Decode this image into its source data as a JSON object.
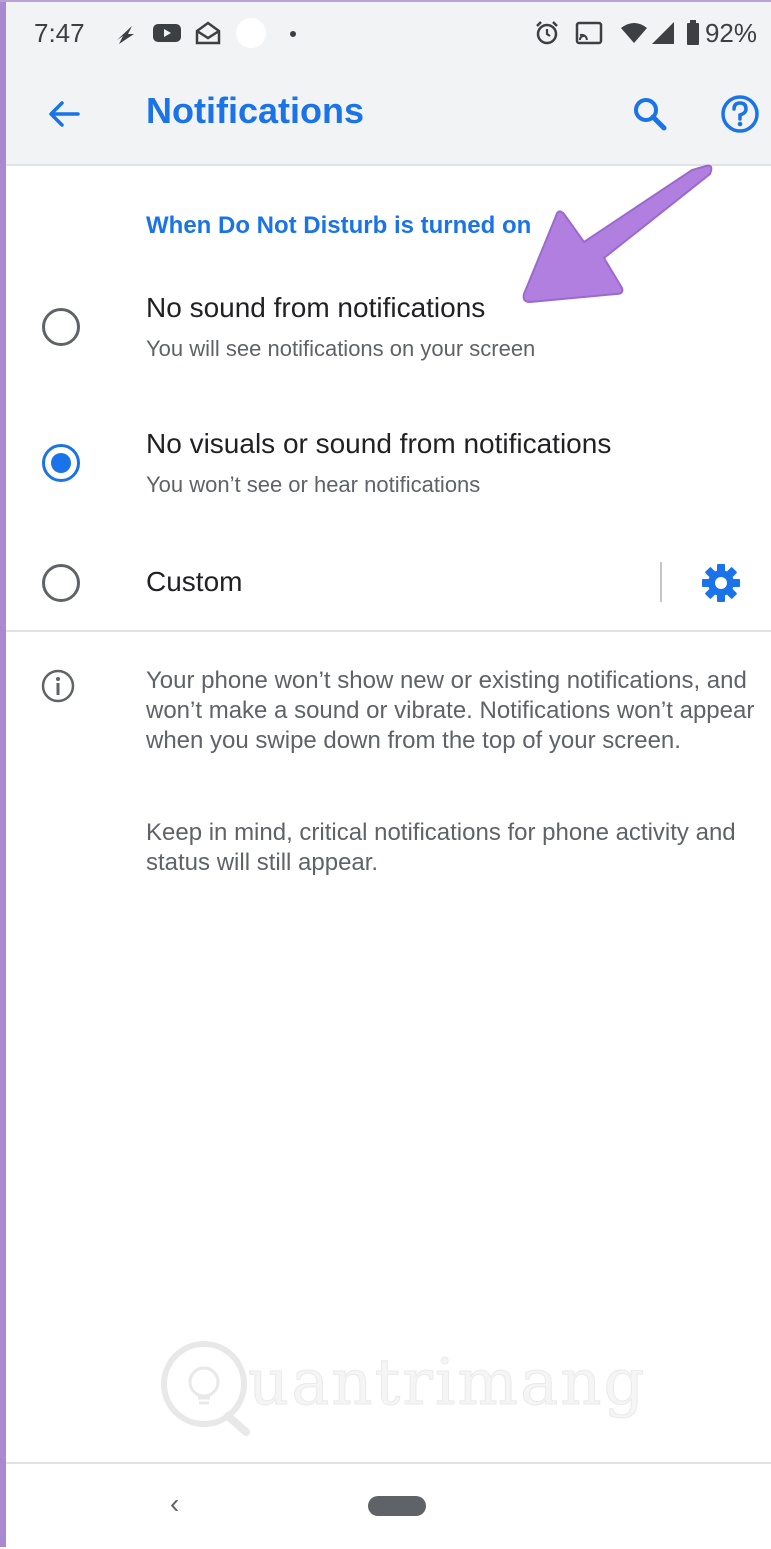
{
  "status_bar": {
    "time": "7:47",
    "battery_percent": "92%",
    "icons": [
      "navigation-icon",
      "youtube-icon",
      "email-icon",
      "circle-icon",
      "dot-icon",
      "alarm-icon",
      "cast-icon",
      "wifi-icon",
      "signal-icon",
      "battery-icon"
    ]
  },
  "app_bar": {
    "title": "Notifications",
    "icons": [
      "back-arrow-icon",
      "search-icon",
      "help-icon"
    ],
    "accent_color": "#1a73e8"
  },
  "section_header": "When Do Not Disturb is turned on",
  "options": [
    {
      "title": "No sound from notifications",
      "subtitle": "You will see notifications on your screen",
      "selected": false
    },
    {
      "title": "No visuals or sound from notifications",
      "subtitle": "You won’t see or hear notifications",
      "selected": true
    },
    {
      "title": "Custom",
      "subtitle": "",
      "selected": false
    }
  ],
  "info": {
    "paragraph1": "Your phone won’t show new or existing notifications, and won’t make a sound or vibrate. Notifications won’t appear when you swipe down from the top of your screen.",
    "paragraph2": "Keep in mind, critical notifications for phone activity and status will still appear."
  },
  "annotation_arrow_color": "#b07fe0",
  "watermark": "uantrimang",
  "nav_bar": {
    "back_glyph": "‹"
  }
}
